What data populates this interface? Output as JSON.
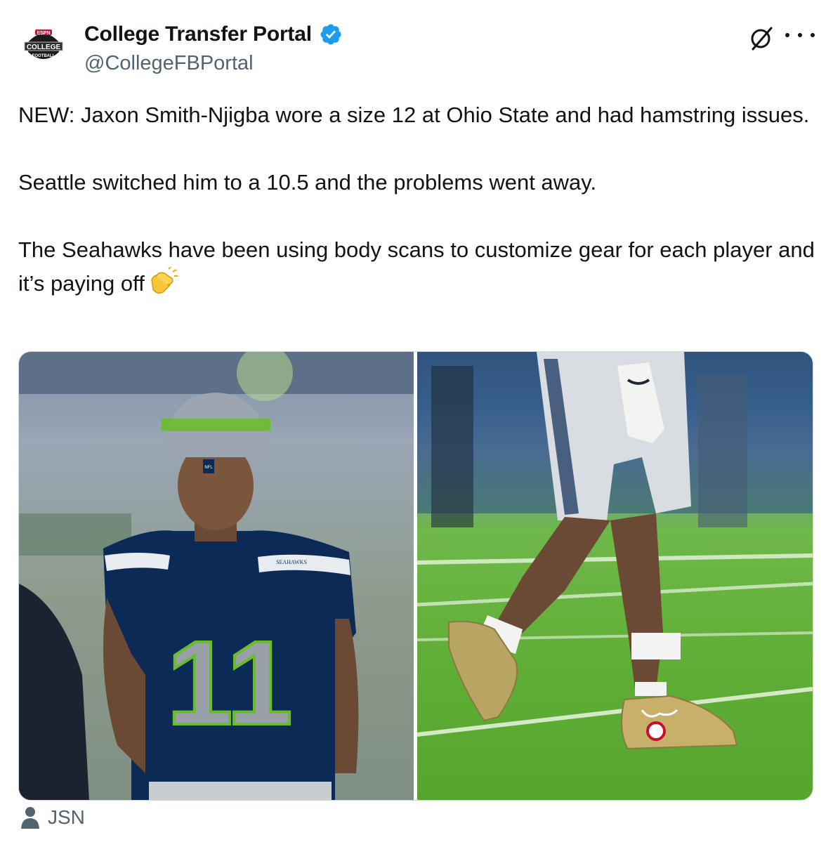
{
  "author": {
    "display_name": "College Transfer Portal",
    "handle": "@CollegeFBPortal",
    "avatar_text_top": "ESPN",
    "avatar_text_main": "COLLEGE",
    "avatar_text_sub": "FOOTBALL"
  },
  "tweet": {
    "paragraphs": [
      "NEW: Jaxon Smith-Njigba wore a size 12 at Ohio State and had hamstring issues.",
      "Seattle switched him to a 10.5 and the problems went away.",
      "The Seahawks have been using body scans to customize gear for each player and it’s paying off"
    ],
    "emoji": "clapping-hands-icon"
  },
  "media": {
    "left_photo": {
      "beanie_logo": "NFL",
      "jersey_text": "SEAHAWKS",
      "jersey_number": "11"
    },
    "right_photo": {}
  },
  "attribution": {
    "label": "JSN"
  },
  "colors": {
    "verified": "#1d9bf0",
    "handle": "#536471",
    "seahawks_navy": "#0b2a55",
    "action_green": "#69be28"
  }
}
